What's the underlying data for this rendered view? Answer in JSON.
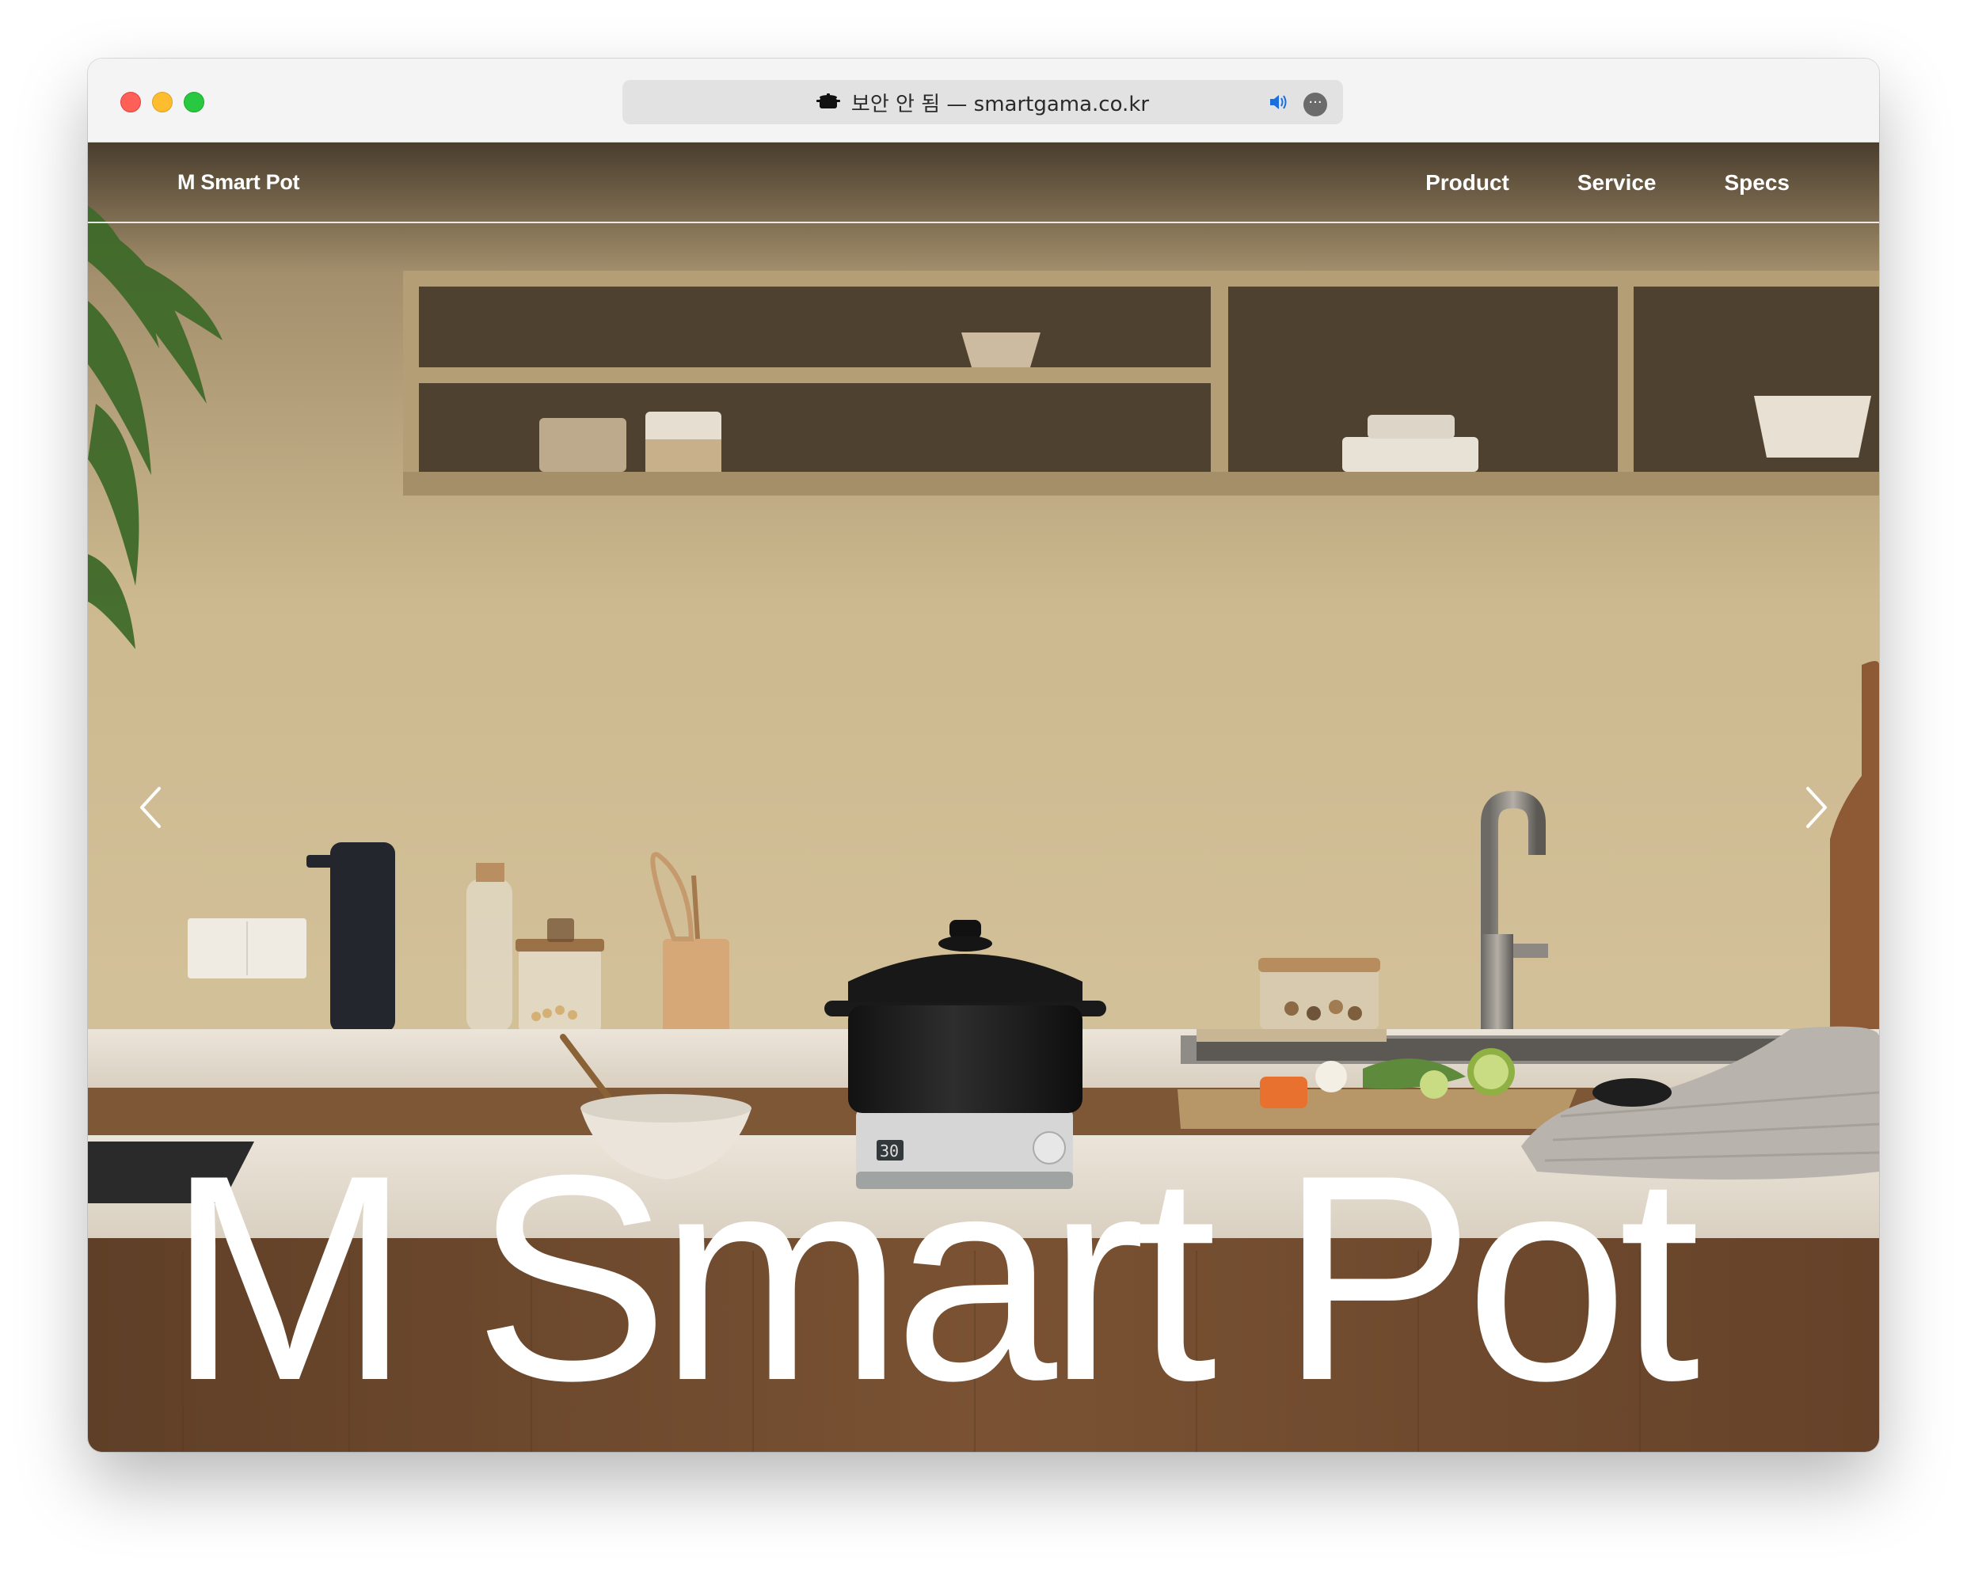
{
  "browser": {
    "url_text": "보안 안 됨 — smartgama.co.kr",
    "favicon": "pot-icon",
    "audio_icon": "speaker-icon",
    "more_icon": "more-icon",
    "more_glyph": "···"
  },
  "nav": {
    "brand": "M Smart Pot",
    "items": [
      {
        "label": "Product"
      },
      {
        "label": "Service"
      },
      {
        "label": "Specs"
      }
    ]
  },
  "hero": {
    "title": "M Smart Pot",
    "cooker_display": "30"
  },
  "carousel": {
    "prev_icon": "chevron-left-icon",
    "next_icon": "chevron-right-icon"
  },
  "colors": {
    "wall": "#cdb890",
    "shelf": "#b09a74",
    "counter": "#e8e1d6",
    "wood": "#6d4a2e",
    "nav_text": "#ffffff"
  }
}
